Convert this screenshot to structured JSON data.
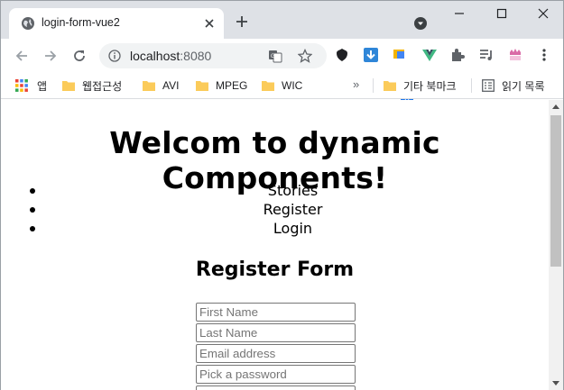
{
  "browser": {
    "tab_title": "login-form-vue2",
    "url_host": "localhost",
    "url_port": ":8080",
    "extension_badge": "0"
  },
  "bookmarks": {
    "apps_label": "앱",
    "items": [
      "웹접근성",
      "AVI",
      "MPEG",
      "WIC"
    ],
    "overflow": "»",
    "other_bookmarks": "기타 북마크",
    "reading_list": "읽기 목록"
  },
  "page": {
    "heading": "Welcom to dynamic Components!",
    "nav": [
      "Stories",
      "Register",
      "Login"
    ],
    "form_title": "Register Form",
    "fields": {
      "first_name_placeholder": "First Name",
      "last_name_placeholder": "Last Name",
      "email_placeholder": "Email address",
      "password_placeholder": "Pick a password"
    }
  },
  "colors": {
    "tabstrip": "#dee1e6",
    "folder": "#fbcb5a",
    "accent_blue": "#1a73e8"
  }
}
